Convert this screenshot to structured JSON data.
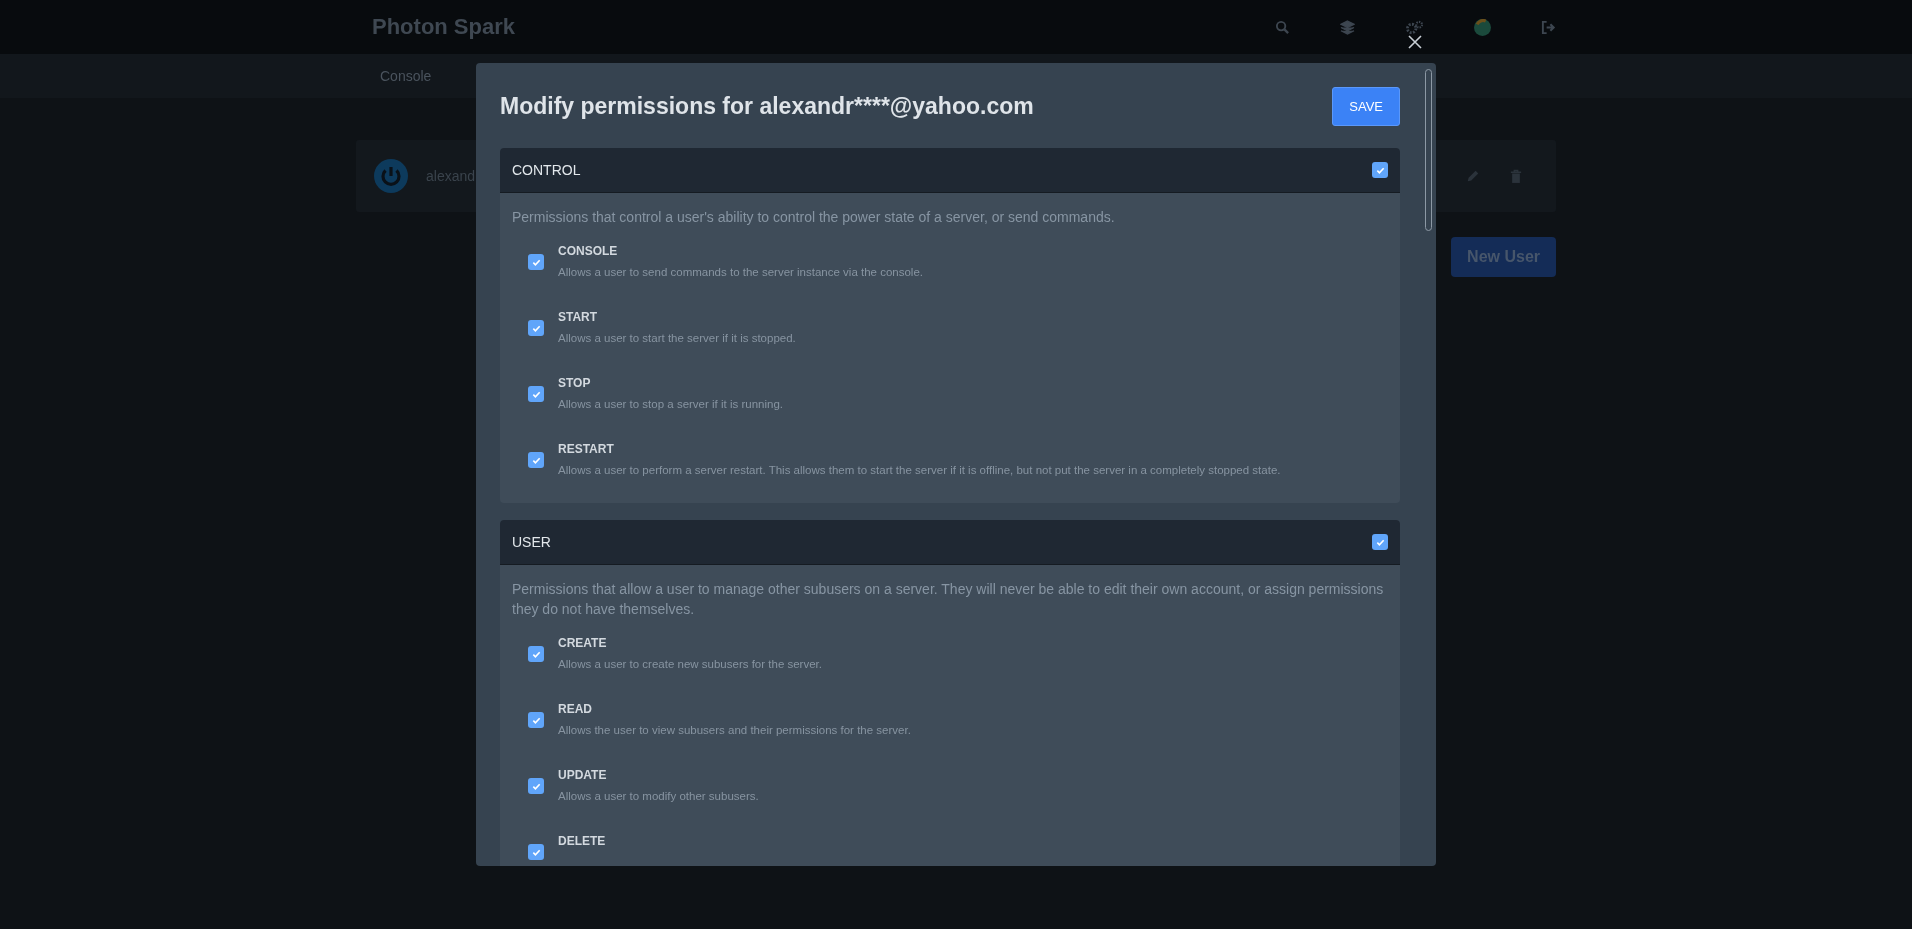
{
  "app": {
    "title": "Photon Spark"
  },
  "nav": [
    {
      "label": "Console"
    }
  ],
  "user_row": {
    "email": "alexand"
  },
  "new_user_button": "New User",
  "modal": {
    "title": "Modify permissions for alexandr****@yahoo.com",
    "save": "SAVE",
    "sections": [
      {
        "title": "CONTROL",
        "checked": true,
        "description": "Permissions that control a user's ability to control the power state of a server, or send commands.",
        "items": [
          {
            "label": "CONSOLE",
            "checked": true,
            "description": "Allows a user to send commands to the server instance via the console."
          },
          {
            "label": "START",
            "checked": true,
            "description": "Allows a user to start the server if it is stopped."
          },
          {
            "label": "STOP",
            "checked": true,
            "description": "Allows a user to stop a server if it is running."
          },
          {
            "label": "RESTART",
            "checked": true,
            "description": "Allows a user to perform a server restart. This allows them to start the server if it is offline, but not put the server in a completely stopped state."
          }
        ]
      },
      {
        "title": "USER",
        "checked": true,
        "description": "Permissions that allow a user to manage other subusers on a server. They will never be able to edit their own account, or assign permissions they do not have themselves.",
        "items": [
          {
            "label": "CREATE",
            "checked": true,
            "description": "Allows a user to create new subusers for the server."
          },
          {
            "label": "READ",
            "checked": true,
            "description": "Allows the user to view subusers and their permissions for the server."
          },
          {
            "label": "UPDATE",
            "checked": true,
            "description": "Allows a user to modify other subusers."
          },
          {
            "label": "DELETE",
            "checked": true
          }
        ]
      }
    ]
  }
}
